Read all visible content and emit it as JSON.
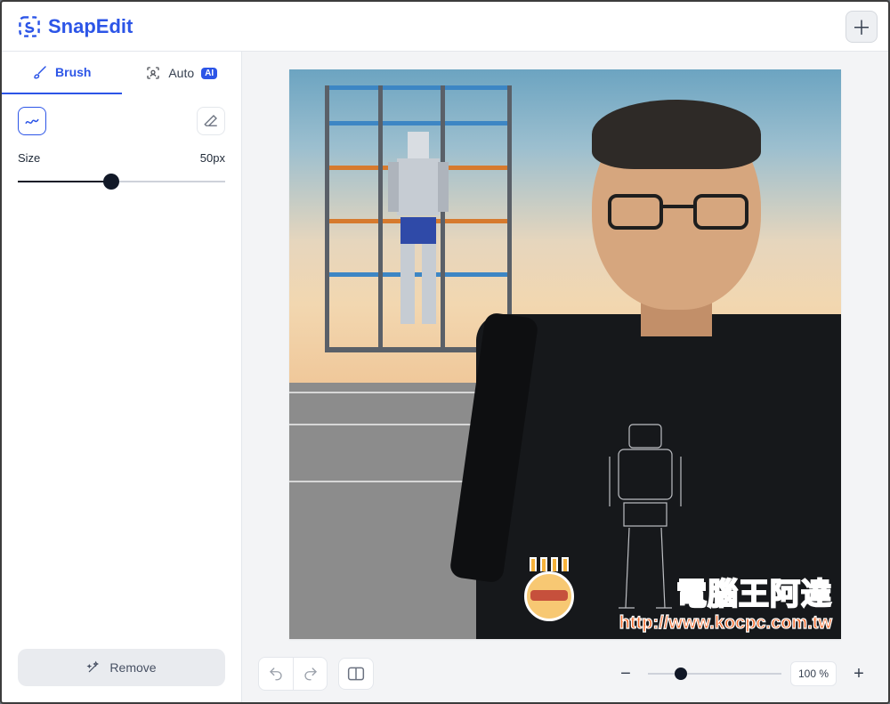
{
  "app": {
    "name": "SnapEdit"
  },
  "topbar": {
    "add_button_icon": "plus-icon"
  },
  "tabs": {
    "brush": {
      "label": "Brush",
      "active": true
    },
    "auto": {
      "label": "Auto",
      "badge": "AI",
      "active": false
    }
  },
  "tools": {
    "scribble_selected": true,
    "eraser_selected": false,
    "size_label": "Size",
    "size_value_label": "50px",
    "size_fraction": 0.45
  },
  "actions": {
    "remove_label": "Remove"
  },
  "bottom": {
    "undo_icon": "undo-icon",
    "redo_icon": "redo-icon",
    "compare_icon": "compare-icon",
    "zoom_label": "100 %",
    "zoom_fraction": 0.25
  },
  "canvas": {
    "watermark_text": "電腦王阿達",
    "watermark_url": "http://www.kocpc.com.tw"
  }
}
